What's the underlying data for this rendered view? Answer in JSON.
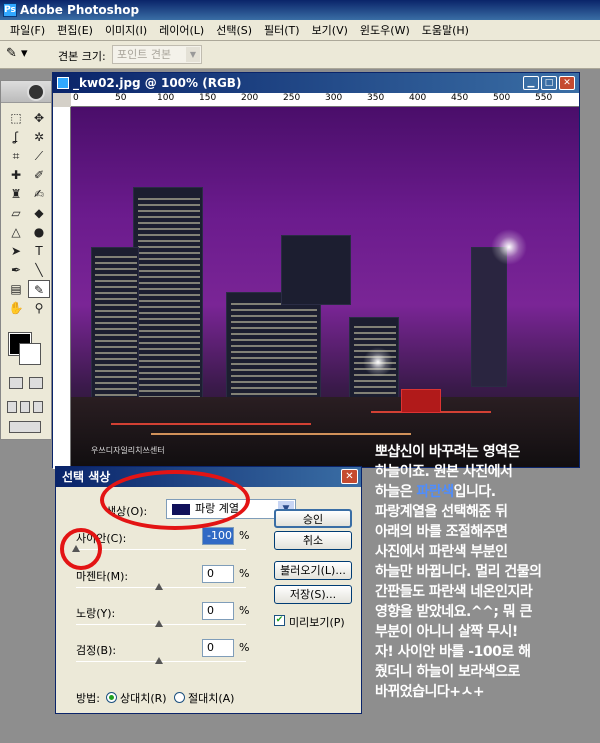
{
  "app": {
    "title": "Adobe Photoshop"
  },
  "menu": [
    "파일(F)",
    "편집(E)",
    "이미지(I)",
    "레이어(L)",
    "선택(S)",
    "필터(T)",
    "보기(V)",
    "윈도우(W)",
    "도움말(H)"
  ],
  "options": {
    "label": "견본 크기:",
    "value": "포인트 견본"
  },
  "document": {
    "title": "_kw02.jpg @ 100% (RGB)",
    "ruler_labels": [
      "0",
      "50",
      "100",
      "150",
      "200",
      "250",
      "300",
      "350",
      "400",
      "450",
      "500",
      "550"
    ],
    "photo_watermark": "우쓰디자일리치쓰센터"
  },
  "dialog": {
    "title": "선택 색상",
    "color_label": "색상(O):",
    "color_value": "파랑 계열",
    "sliders": [
      {
        "label": "사이안(C):",
        "value": "-100",
        "percent": "%",
        "fraction": 0.0
      },
      {
        "label": "마젠타(M):",
        "value": "0",
        "percent": "%",
        "fraction": 0.5
      },
      {
        "label": "노랑(Y):",
        "value": "0",
        "percent": "%",
        "fraction": 0.5
      },
      {
        "label": "검정(B):",
        "value": "0",
        "percent": "%",
        "fraction": 0.5
      }
    ],
    "buttons": [
      "승인",
      "취소",
      "불러오기(L)...",
      "저장(S)..."
    ],
    "preview_label": "미리보기(P)",
    "preview_checked": true,
    "method_label": "방법:",
    "method_options": [
      "상대치(R)",
      "절대치(A)"
    ],
    "method_selected": "상대치(R)"
  },
  "note": {
    "line1": "뽀샵신이 바꾸려는 영역은",
    "line2": "하늘이죠. 원본 사진에서",
    "line3_pre": "하늘은 ",
    "line3_hl": "파란색",
    "line3_post": "입니다.",
    "line4": "파랑계열을 선택해준 뒤",
    "line5": "아래의 바를 조절해주면",
    "line6": "사진에서 파란색 부분인",
    "line7": "하늘만 바뀝니다. 멀리 건물의",
    "line8": "간판들도 파란색 네온인지라",
    "line9": "영향을 받았네요.^^; 뭐 큰",
    "line10": "부분이 아니니 살짝 무시!",
    "line11": "자! 사이안 바를 -100로 해",
    "line12": "줬더니 하늘이 보라색으로",
    "line13": "바뀌었습니다+ㅅ+"
  },
  "colors": {
    "title_bar": "#0a246a",
    "highlight": "#4e8dff",
    "annotation": "#e31414",
    "swatch": "#10105a"
  }
}
